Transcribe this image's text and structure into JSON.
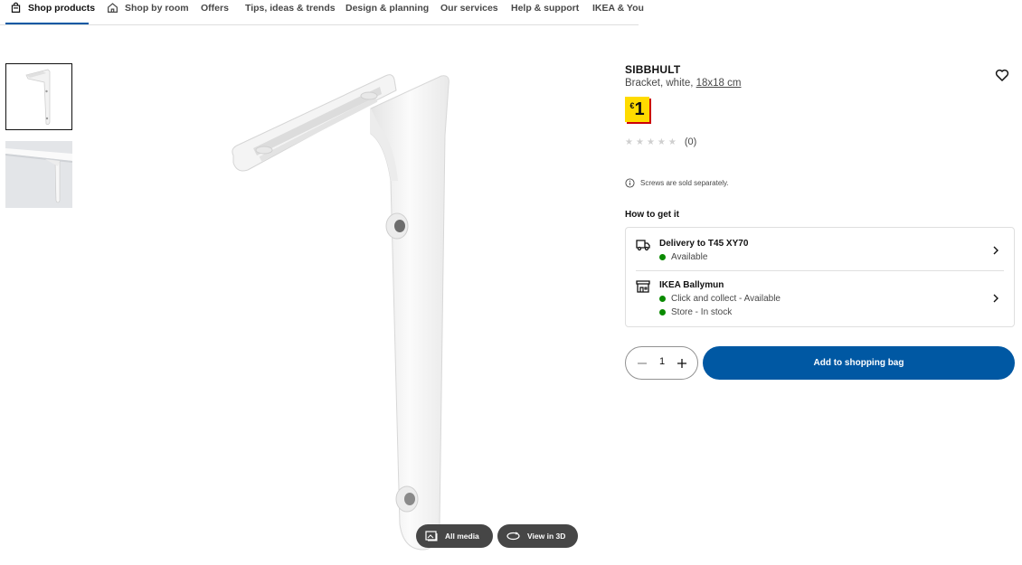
{
  "nav": {
    "items": [
      {
        "label": "Shop products"
      },
      {
        "label": "Shop by room"
      },
      {
        "label": "Offers"
      },
      {
        "label": "Tips, ideas & trends"
      },
      {
        "label": "Design & planning"
      },
      {
        "label": "Our services"
      },
      {
        "label": "Help & support"
      },
      {
        "label": "IKEA & You"
      }
    ],
    "active": "Shop products"
  },
  "gallery": {
    "thumbnails": [
      "bracket-front",
      "bracket-in-use"
    ],
    "selected_index": 0,
    "buttons": {
      "all_media": "All media",
      "view_3d": "View in 3D"
    }
  },
  "product": {
    "name": "SIBBHULT",
    "description": "Bracket, white, ",
    "size": "18x18 cm",
    "price_currency": "€",
    "price_amount": "1",
    "rating_count": "(0)",
    "note": "Screws are sold separately."
  },
  "availability": {
    "heading": "How to get it",
    "delivery": {
      "title": "Delivery to T45 XY70",
      "status": "Available"
    },
    "store": {
      "title": "IKEA Ballymun",
      "collect": "Click and collect - Available",
      "stock": "Store - In stock"
    }
  },
  "purchase": {
    "quantity": "1",
    "add_label": "Add to shopping bag"
  },
  "colors": {
    "brand_blue": "#0058a3",
    "price_yellow": "#ffdb00",
    "price_red": "#cc0008",
    "available_green": "#0a8a00"
  }
}
